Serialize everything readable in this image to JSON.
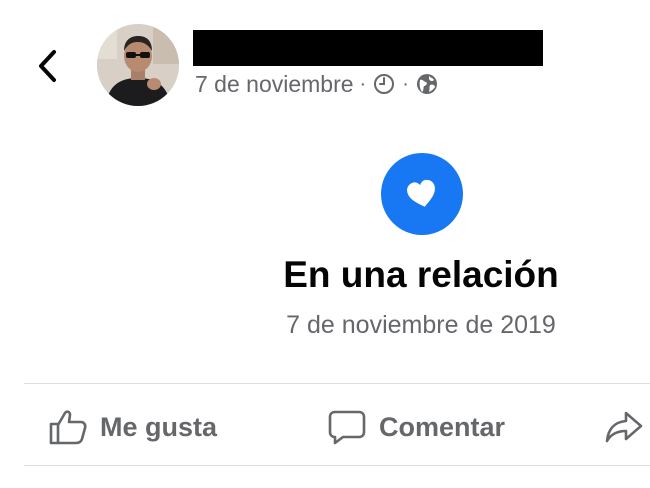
{
  "header": {
    "back_icon": "chevron-left-icon",
    "name_redacted": true,
    "date": "7 de noviembre",
    "separator": "·",
    "icons": [
      "clock-icon",
      "globe-icon"
    ]
  },
  "event": {
    "icon": "heart-icon",
    "icon_bg_color": "#1877f2",
    "title": "En una relación",
    "date": "7 de noviembre de 2019"
  },
  "actions": {
    "like_label": "Me gusta",
    "comment_label": "Comentar",
    "share_icon": "share-icon"
  },
  "colors": {
    "secondary_text": "#65676b",
    "divider": "#dadde1"
  }
}
